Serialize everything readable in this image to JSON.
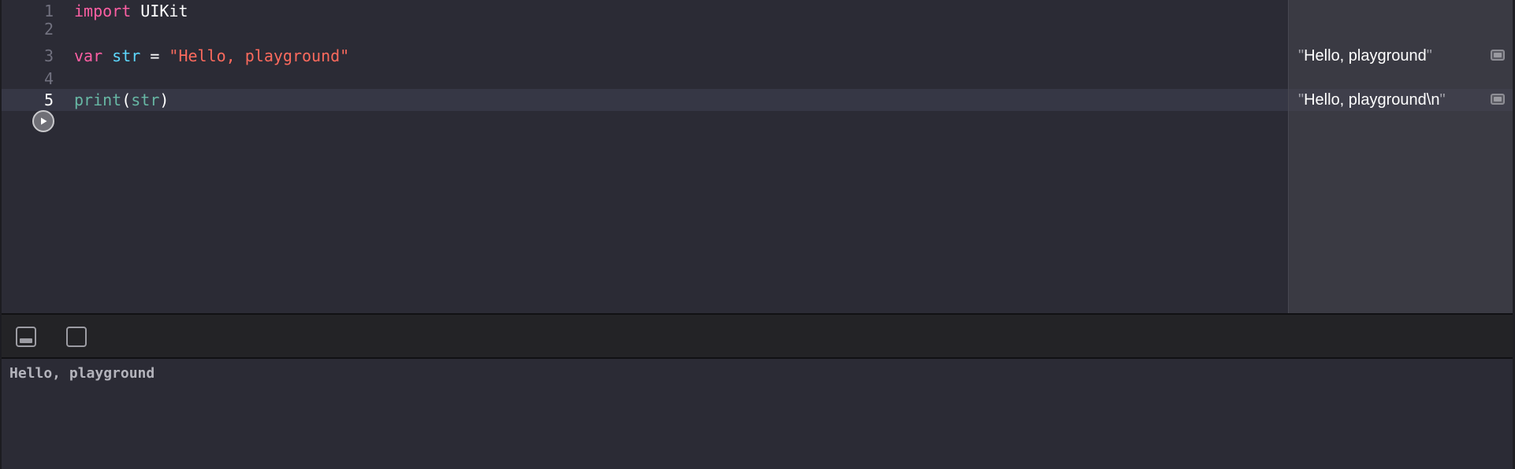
{
  "editor": {
    "lines": [
      {
        "number": "1",
        "tokens": [
          {
            "type": "kw",
            "text": "import"
          },
          {
            "type": "plain",
            "text": " UIKit"
          }
        ]
      },
      {
        "number": "2",
        "tokens": []
      },
      {
        "number": "3",
        "tokens": [
          {
            "type": "kw",
            "text": "var"
          },
          {
            "type": "plain",
            "text": " "
          },
          {
            "type": "var",
            "text": "str"
          },
          {
            "type": "plain",
            "text": " = "
          },
          {
            "type": "str",
            "text": "\"Hello, playground\""
          }
        ]
      },
      {
        "number": "4",
        "tokens": []
      },
      {
        "number": "5",
        "tokens": [
          {
            "type": "fn",
            "text": "print"
          },
          {
            "type": "plain",
            "text": "("
          },
          {
            "type": "fn",
            "text": "str"
          },
          {
            "type": "plain",
            "text": ")"
          }
        ]
      }
    ],
    "current_line": "5",
    "run_icon": "play-icon"
  },
  "results": [
    {
      "line": "3",
      "quote_open": "\"",
      "value": "Hello, playground",
      "quote_close": "\"",
      "icon": "quick-look-icon"
    },
    {
      "line": "5",
      "quote_open": "\"",
      "value": "Hello, playground\\n",
      "quote_close": "\"",
      "icon": "quick-look-icon"
    }
  ],
  "debug_bar": {
    "buttons": [
      {
        "name": "hide-debug-area-icon"
      },
      {
        "name": "show-results-icon"
      }
    ]
  },
  "console": {
    "output": "Hello, playground"
  },
  "colors": {
    "keyword": "#fc5fa3",
    "variable": "#5dd8ff",
    "string": "#fc6a5d",
    "function": "#67b7a4",
    "background": "#2b2b35"
  }
}
